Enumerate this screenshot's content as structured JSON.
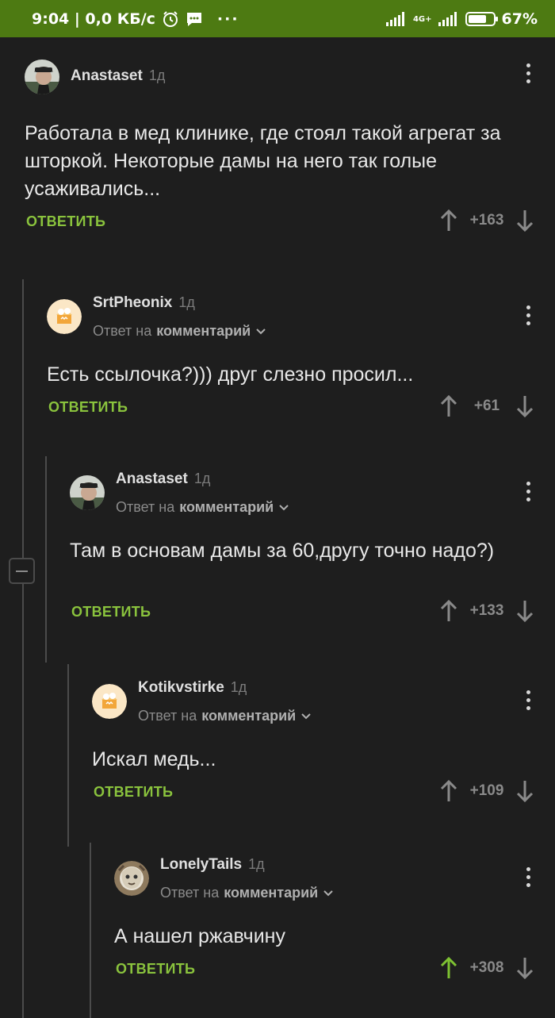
{
  "status_bar": {
    "left_text": "9:04 | 0,0 КБ/с",
    "more": "···",
    "network": "4G+",
    "battery": "67%"
  },
  "reply_to_prefix": "Ответ на",
  "reply_to_link": "комментарий",
  "reply_label": "ОТВЕТИТЬ",
  "comments": [
    {
      "author": "Anastaset",
      "time": "1д",
      "text": "Работала в мед клинике, где стоял такой агрегат за шторкой. Некоторые дамы на него так голые усаживались...",
      "score": "+163"
    },
    {
      "author": "SrtPheonix",
      "time": "1д",
      "text": "Есть ссылочка?))) друг слезно просил...",
      "score": "+61"
    },
    {
      "author": "Anastaset",
      "time": "1д",
      "text": "Там в основам дамы за 60,другу точно надо?)",
      "score": "+133"
    },
    {
      "author": "Kotikvstirke",
      "time": "1д",
      "text": "Искал медь...",
      "score": "+109"
    },
    {
      "author": "LonelyTails",
      "time": "1д",
      "text": "А нашел ржавчину",
      "score": "+308",
      "upvoted": true
    }
  ],
  "colors": {
    "status_bar": "#4d7a12",
    "background": "#1e1e1e",
    "accent_green": "#8ac33d",
    "upvote_active": "#7ec232"
  }
}
